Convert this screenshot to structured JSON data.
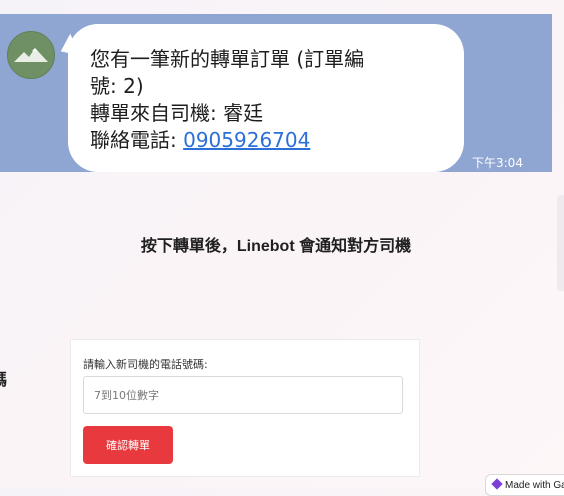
{
  "chat": {
    "message_line1": "您有一筆新的轉單訂單 (訂單編",
    "message_line2": "號: 2)",
    "message_line3": "轉單來自司機: 睿廷",
    "message_line4_label": "聯絡電話: ",
    "phone_number": "0905926704",
    "timestamp": "下午3:04"
  },
  "caption": "按下轉單後，Linebot 會通知對方司機",
  "edge_char": "碼",
  "form": {
    "label": "請輸入新司機的電話號碼:",
    "input_placeholder": "7到10位數字",
    "input_value": "",
    "confirm_button": "確認轉單"
  },
  "badge": {
    "text": "Made with Ga"
  },
  "colors": {
    "chat_background": "#8fa6d3",
    "link": "#2c6fd8",
    "confirm_button": "#e83a3e"
  },
  "icons": {
    "avatar": "mountain-avatar-icon",
    "badge_logo": "gamma-logo-icon"
  }
}
